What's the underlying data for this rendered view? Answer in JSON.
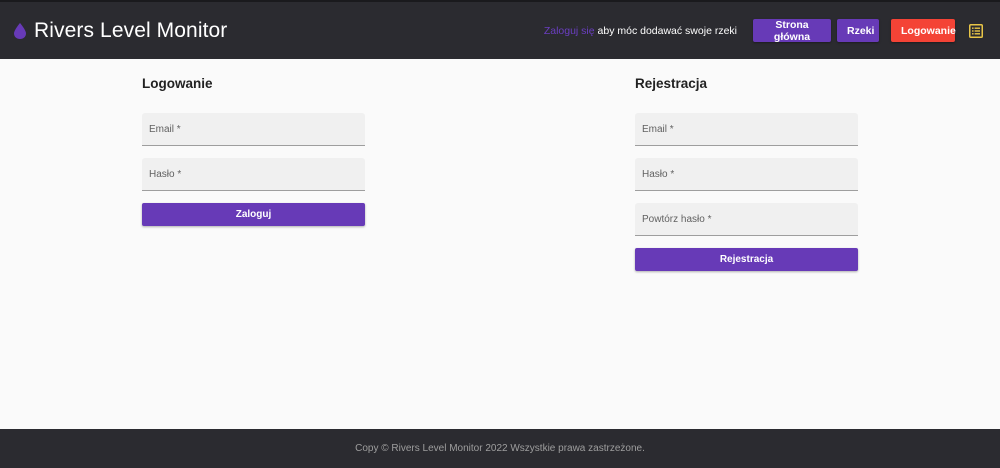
{
  "header": {
    "title": "Rivers Level Monitor",
    "logo_icon": "water-drop-icon",
    "accent_color": "#673ab7",
    "hint_link": "Zaloguj się",
    "hint_text": " aby móc dodawać swoje rzeki",
    "nav": {
      "home_label": "Strona główna",
      "rivers_label": "Rzeki",
      "login_label": "Logowanie"
    },
    "menu_icon": "list-icon"
  },
  "login": {
    "title": "Logowanie",
    "email_placeholder": "Email *",
    "password_placeholder": "Hasło *",
    "submit_label": "Zaloguj"
  },
  "register": {
    "title": "Rejestracja",
    "email_placeholder": "Email *",
    "password_placeholder": "Hasło *",
    "repeat_password_placeholder": "Powtórz hasło *",
    "submit_label": "Rejestracja"
  },
  "footer": {
    "text": "Copy © Rivers Level Monitor 2022 Wszystkie prawa zastrzeżone."
  }
}
